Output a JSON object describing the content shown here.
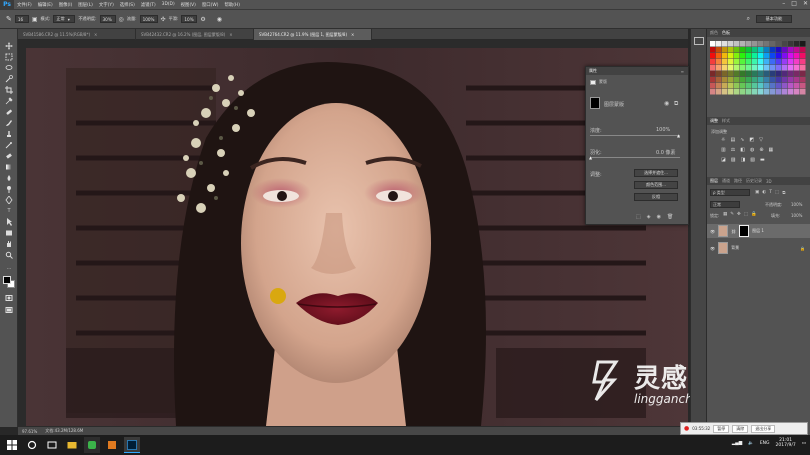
{
  "app": {
    "logo": "Ps"
  },
  "menu": [
    "文件(F)",
    "编辑(E)",
    "图像(I)",
    "图层(L)",
    "文字(Y)",
    "选择(S)",
    "滤镜(T)",
    "3D(D)",
    "视图(V)",
    "窗口(W)",
    "帮助(H)"
  ],
  "options": {
    "mode_label": "模式:",
    "mode_value": "正常",
    "opacity_label": "不透明度:",
    "opacity_value": "30%",
    "flow_label": "流量:",
    "flow_value": "100%",
    "smooth_label": "平滑:",
    "smooth_value": "10%",
    "brush_size": "16",
    "workspace": "基本功能"
  },
  "tabs": [
    {
      "label": "SVB41586.CR2 @ 11.5%(RGB/8*)"
    },
    {
      "label": "SVB42432.CR2 @ 16.2% (图层, 图层蒙版/8)"
    },
    {
      "label": "SVB42764.CR2 @ 11.9% (图层 1, 图层蒙版/8)"
    }
  ],
  "status": {
    "zoom": "97.61%",
    "doc": "文档:43.2M/128.6M"
  },
  "swatches_tabs": [
    "颜色",
    "色板"
  ],
  "adjust_tabs": [
    "调整",
    "样式"
  ],
  "adjust_label": "添加调整",
  "layers_tabs": [
    "图层",
    "通道",
    "路径",
    "历史记录",
    "3D"
  ],
  "layers": {
    "kind_label": "ρ 类型",
    "blend_mode": "正常",
    "opacity_label": "不透明度:",
    "opacity_value": "100%",
    "lock_label": "锁定:",
    "fill_label": "填充:",
    "fill_value": "100%",
    "items": [
      {
        "name": "图层 1"
      },
      {
        "name": "背景"
      }
    ]
  },
  "properties": {
    "title": "属性",
    "subtitle": "蒙版",
    "mask_label": "图层蒙版",
    "density_label": "浓度:",
    "density_value": "100%",
    "feather_label": "羽化:",
    "feather_value": "0.0 像素",
    "refine_label": "调整:",
    "btn_select": "选择并遮住...",
    "btn_color": "颜色范围...",
    "btn_invert": "反相"
  },
  "watermark": {
    "brand": "灵感中国",
    "url": "lingganchina.com"
  },
  "recorder": {
    "time": "03:55:32",
    "btn1": "暂停",
    "btn2": "清除",
    "btn3": "退出分享"
  },
  "taskbar": {
    "lang": "ENG",
    "time": "21:01",
    "date": "2017/9/7"
  },
  "colors": {
    "ps_blue": "#31a8ff",
    "panel": "#535353",
    "lip": "#7a1020",
    "eyeshadow": "#b55068",
    "wood": "#3f2c2d"
  }
}
